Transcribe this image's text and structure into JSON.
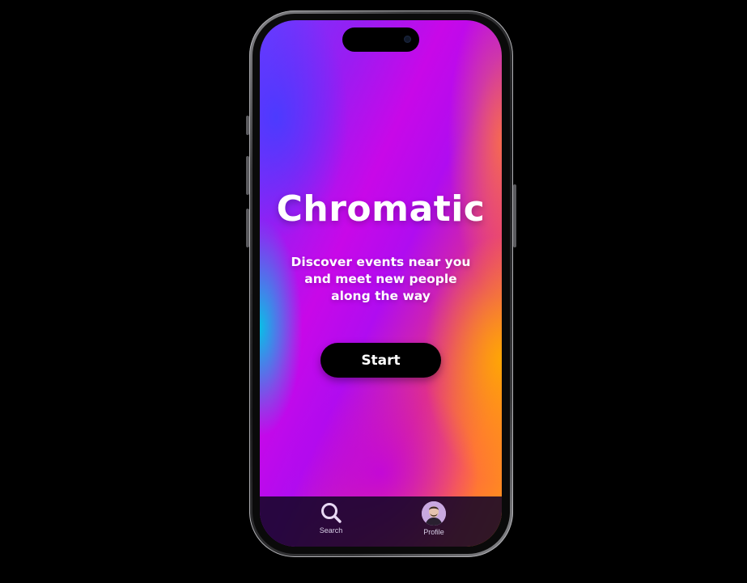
{
  "app": {
    "title": "Chromatic",
    "tagline": "Discover events near you\nand meet new  people\nalong the way"
  },
  "actions": {
    "start_label": "Start"
  },
  "tabbar": {
    "items": [
      {
        "label": "Search",
        "icon": "search-icon"
      },
      {
        "label": "Profile",
        "icon": "avatar"
      }
    ]
  },
  "colors": {
    "background": "#000000",
    "button": "#000000",
    "button_text": "#ffffff",
    "gradient": [
      "#6a3cff",
      "#c808e8",
      "#ff6a40",
      "#ff9a10",
      "#00c8e6"
    ]
  }
}
